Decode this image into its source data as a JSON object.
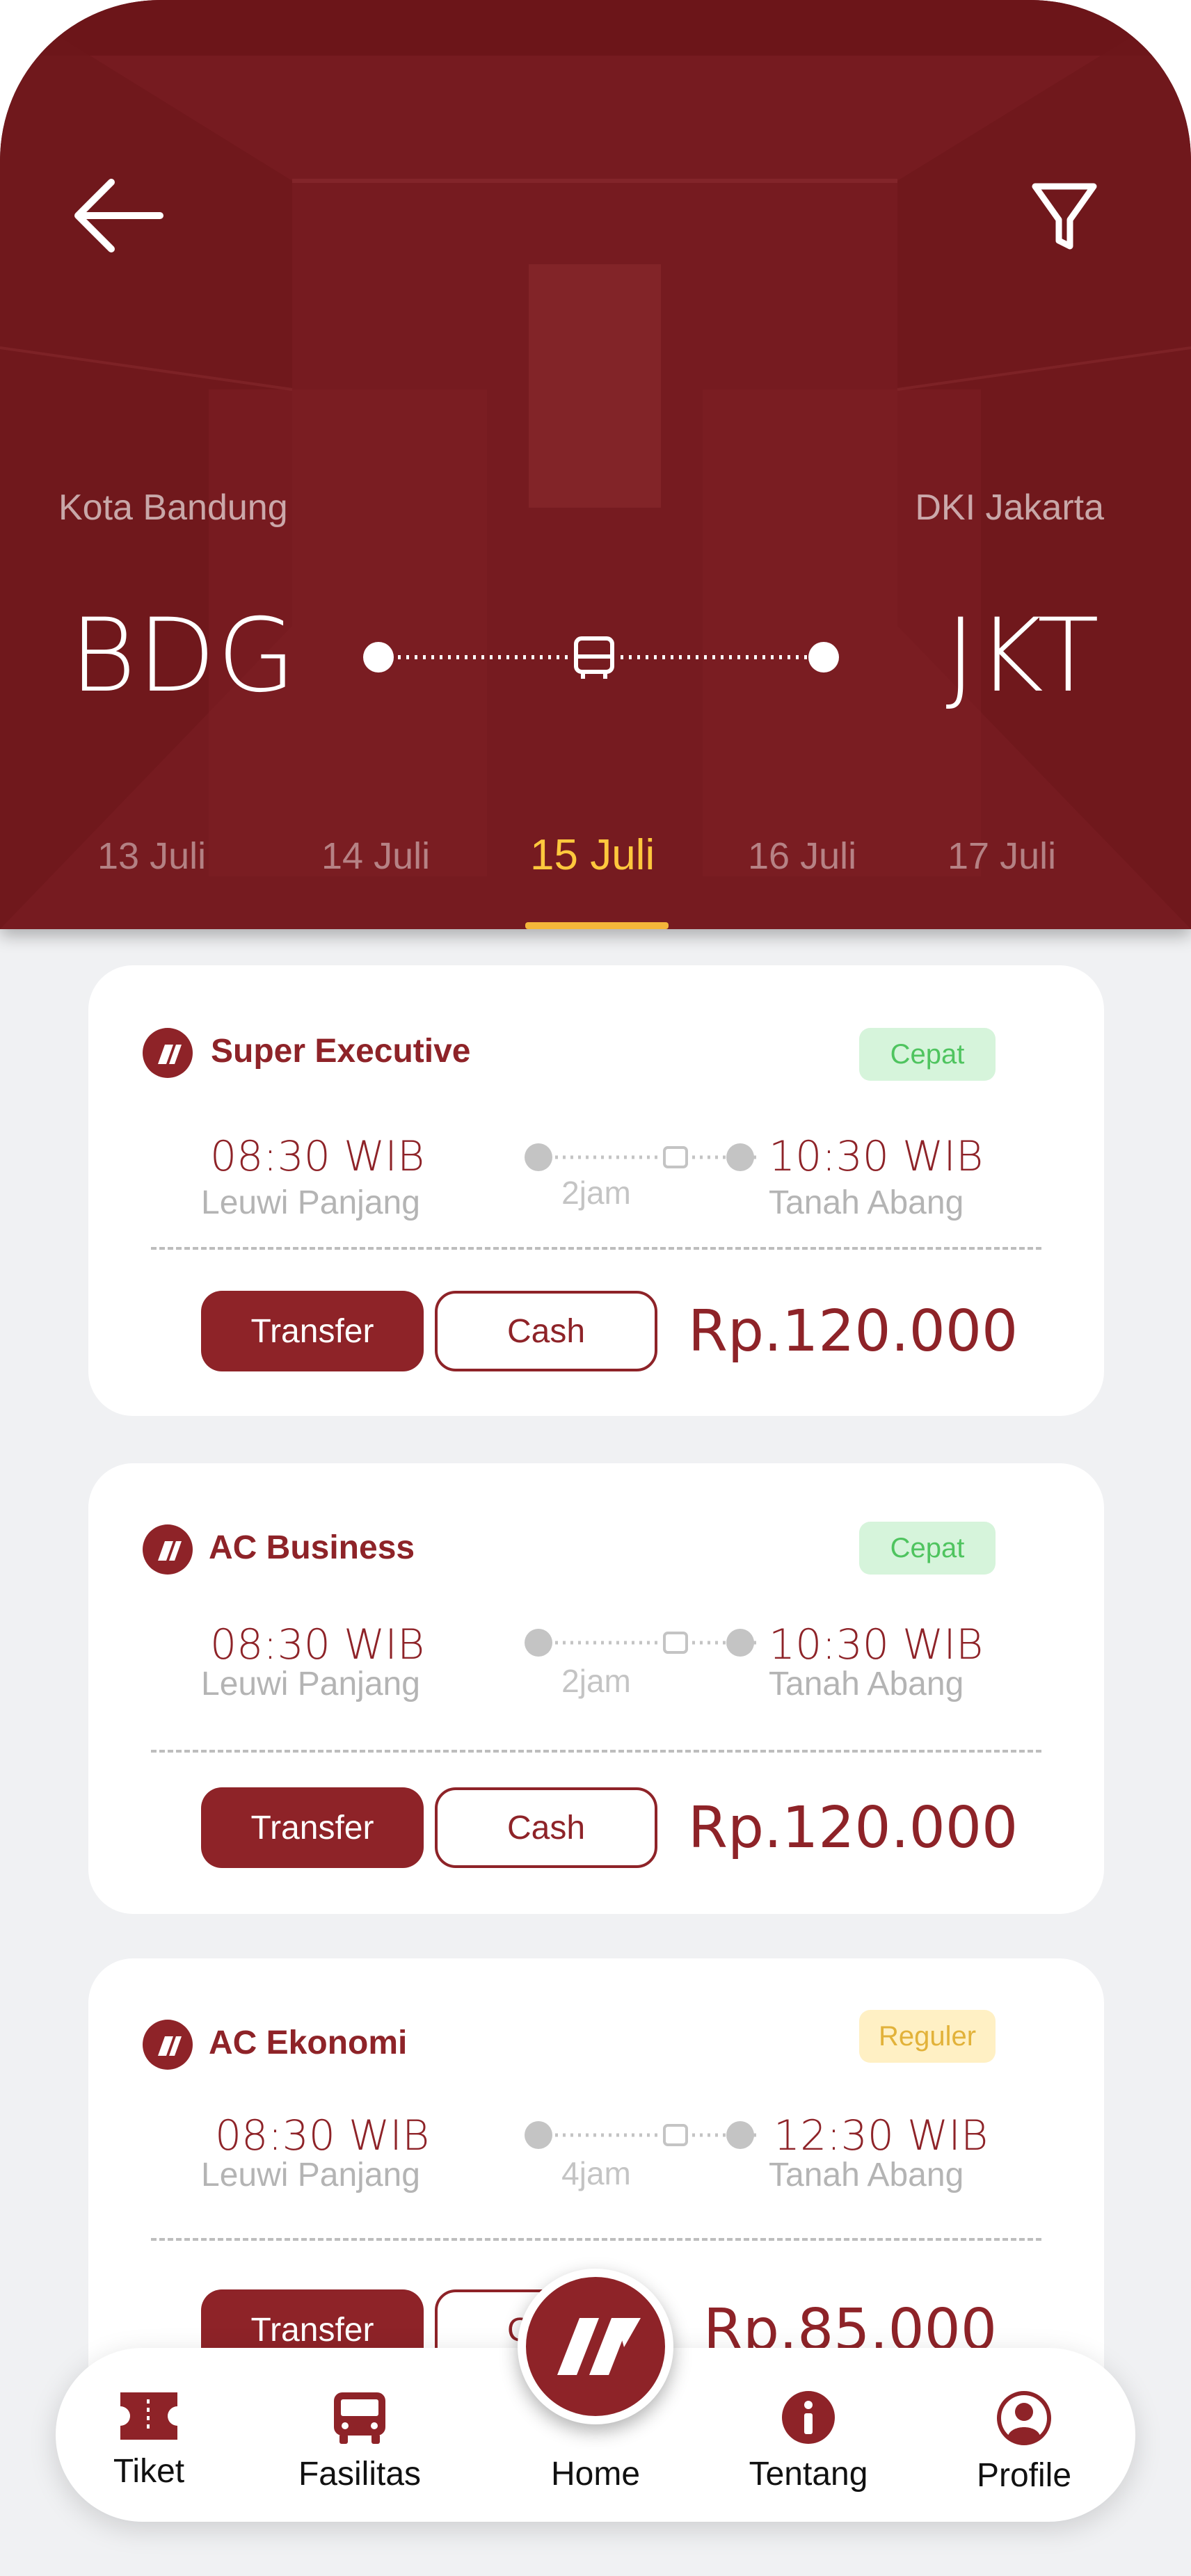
{
  "route": {
    "from_city": "Kota Bandung",
    "to_city": "DKI Jakarta",
    "from_code": "BDG",
    "to_code": "JKT"
  },
  "dates": [
    "13 Juli",
    "14 Juli",
    "15 Juli",
    "16 Juli",
    "17 Juli"
  ],
  "selected_date": "15 Juli",
  "trips": [
    {
      "class": "Super Executive",
      "badge": "Cepat",
      "dep_time": "08:30 WIB",
      "dep_stop": "Leuwi Panjang",
      "duration": "2jam",
      "arr_time": "10:30 WIB",
      "arr_stop": "Tanah Abang",
      "transfer_label": "Transfer",
      "cash_label": "Cash",
      "price": "Rp.120.000"
    },
    {
      "class": "AC Business",
      "badge": "Cepat",
      "dep_time": "08:30 WIB",
      "dep_stop": "Leuwi Panjang",
      "duration": "2jam",
      "arr_time": "10:30 WIB",
      "arr_stop": "Tanah Abang",
      "transfer_label": "Transfer",
      "cash_label": "Cash",
      "price": "Rp.120.000"
    },
    {
      "class": "AC Ekonomi",
      "badge": "Reguler",
      "dep_time": "08:30 WIB",
      "dep_stop": "Leuwi Panjang",
      "duration": "4jam",
      "arr_time": "12:30 WIB",
      "arr_stop": "Tanah Abang",
      "transfer_label": "Transfer",
      "cash_label": "C",
      "price": "Rp.85.000"
    }
  ],
  "nav": {
    "tiket": "Tiket",
    "fasilitas": "Fasilitas",
    "home": "Home",
    "tentang": "Tentang",
    "profile": "Profile"
  },
  "colors": {
    "brand": "#8e2328",
    "header_bg": "#761b20",
    "active_tab": "#ffc83d",
    "badge_fast": "#4fc45f",
    "badge_regular": "#e2b23a"
  },
  "icons": [
    "back-arrow-icon",
    "filter-icon",
    "bus-icon",
    "brand-logo-icon",
    "ticket-icon",
    "info-icon",
    "user-icon"
  ]
}
